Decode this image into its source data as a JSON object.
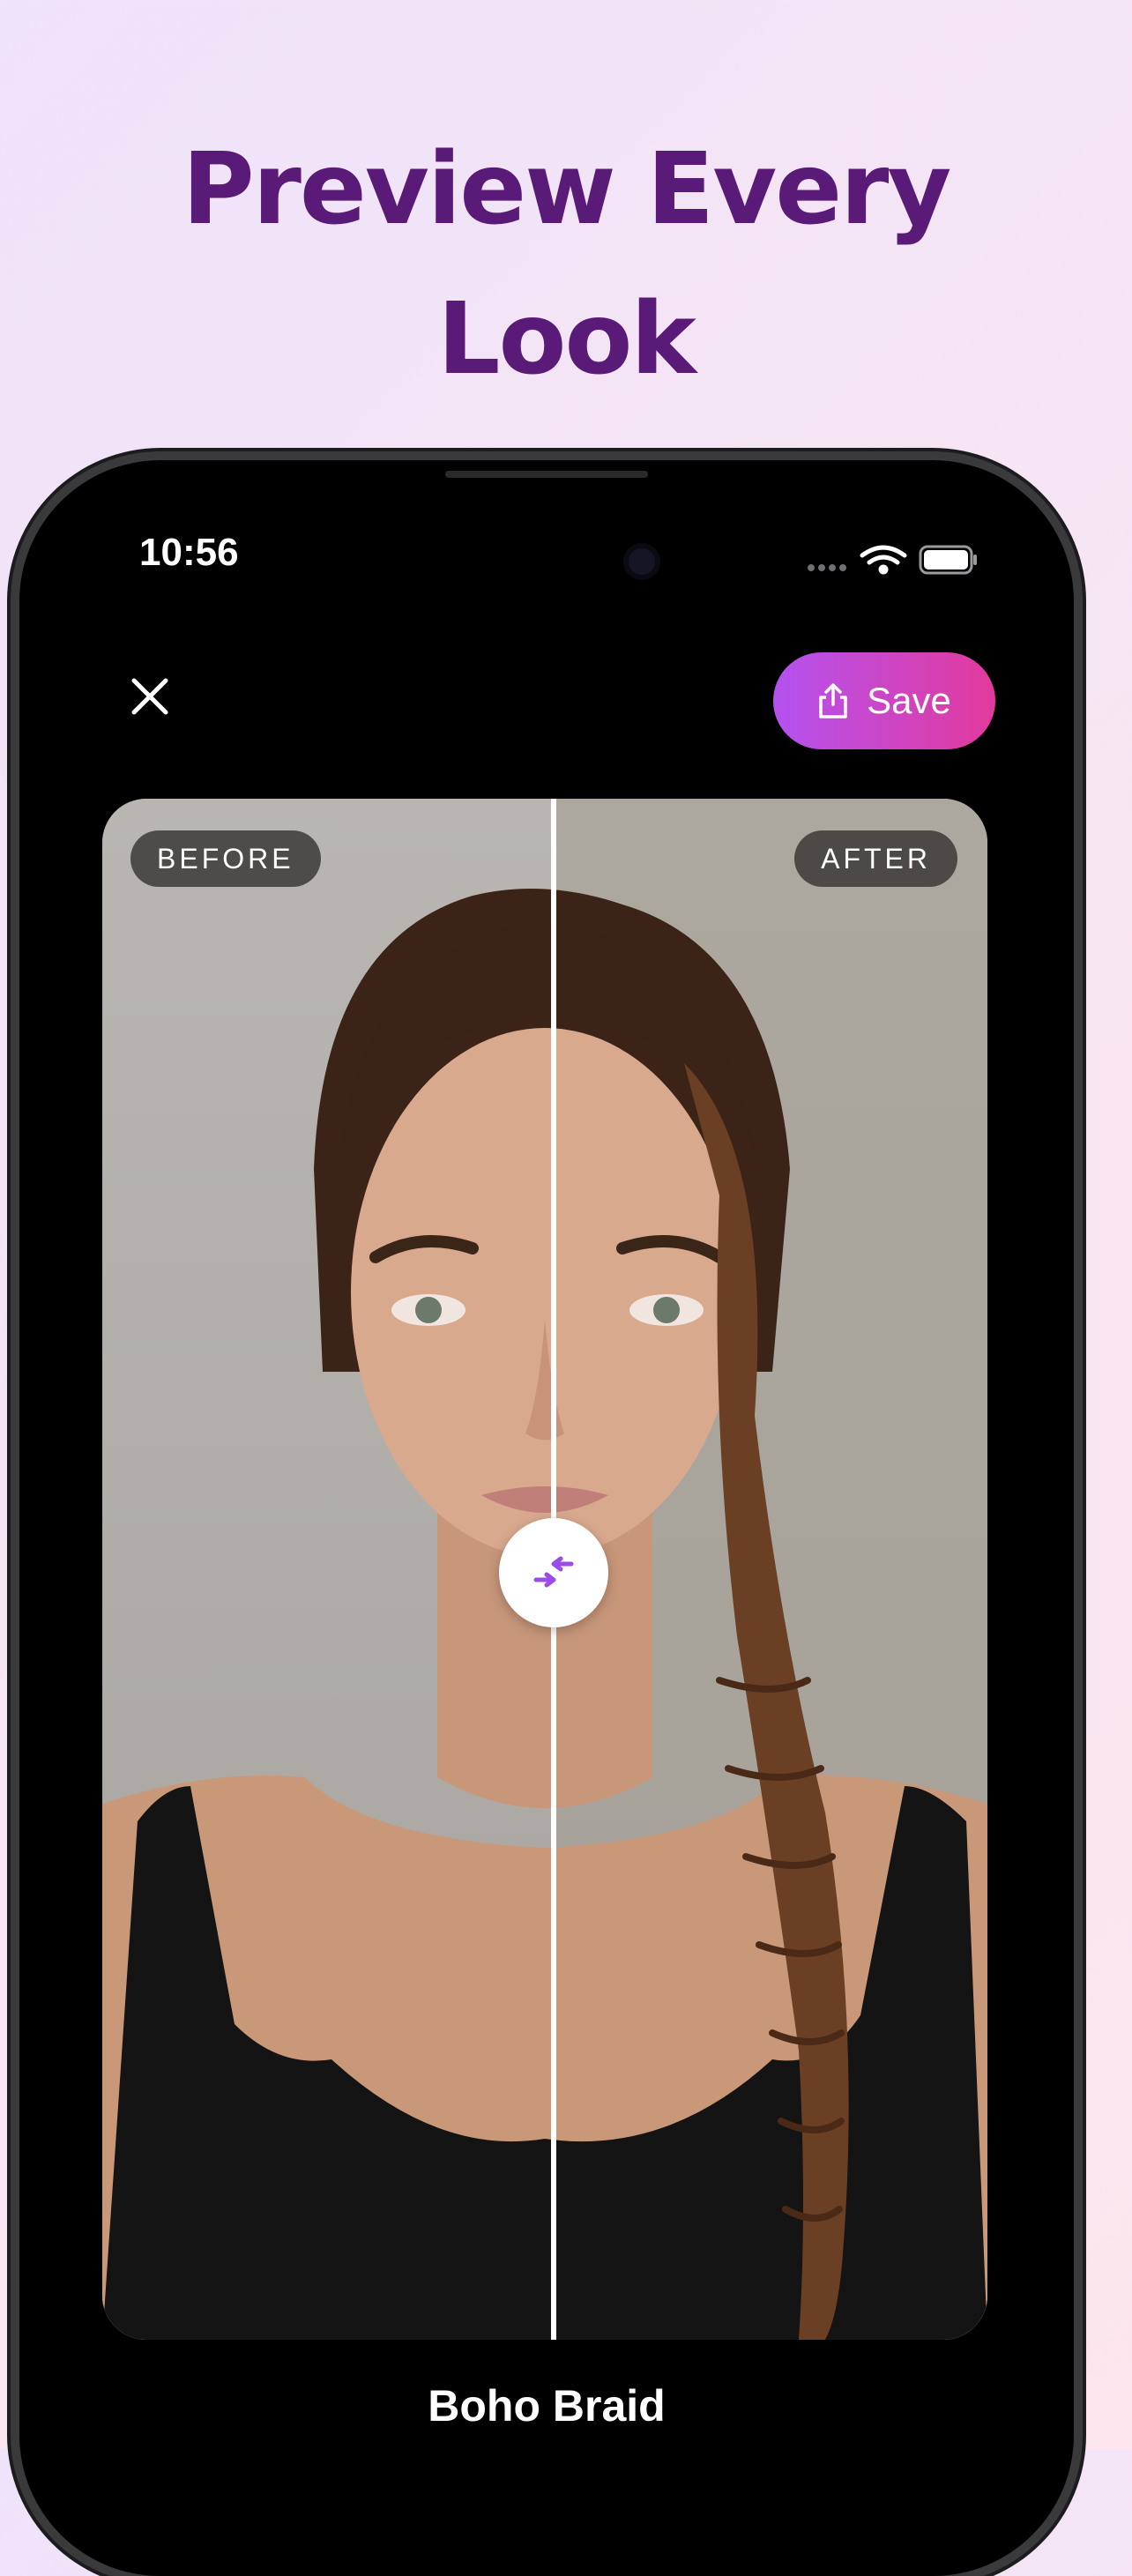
{
  "headline": {
    "line1": "Preview Every",
    "line2": "Look"
  },
  "status_bar": {
    "time": "10:56"
  },
  "toolbar": {
    "save_label": "Save"
  },
  "comparison": {
    "before_label": "BEFORE",
    "after_label": "AFTER",
    "slider_position": 0.5
  },
  "look": {
    "name": "Boho Braid"
  },
  "colors": {
    "headline": "#5a1a78",
    "save_gradient_start": "#b452f0",
    "save_gradient_end": "#e23a9c",
    "handle_icon": "#9b4be6"
  },
  "icons": [
    "close-icon",
    "share-icon",
    "compare-arrows-icon",
    "wifi-icon",
    "battery-icon",
    "signal-icon"
  ]
}
